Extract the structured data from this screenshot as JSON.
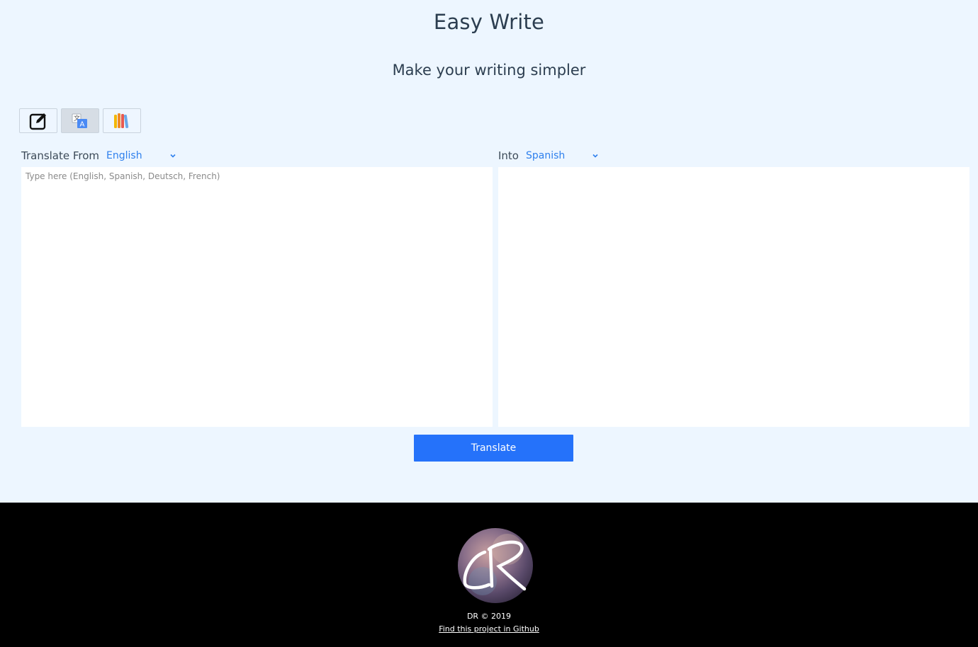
{
  "header": {
    "title": "Easy Write",
    "subtitle": "Make your writing simpler"
  },
  "modes": [
    {
      "name": "edit-mode",
      "icon": "edit-icon",
      "active": false
    },
    {
      "name": "translate-mode",
      "icon": "translate-icon",
      "active": true
    },
    {
      "name": "library-mode",
      "icon": "books-icon",
      "active": false
    }
  ],
  "source": {
    "label": "Translate From",
    "language": "English",
    "placeholder": "Type here (English, Spanish, Deutsch, French)",
    "value": ""
  },
  "target": {
    "label": "Into",
    "language": "Spanish",
    "value": ""
  },
  "actions": {
    "translate_label": "Translate"
  },
  "footer": {
    "logo": "dr-logo",
    "copyright": "DR © 2019",
    "github_link": "Find this project in Github"
  },
  "colors": {
    "background": "#edf6ff",
    "accent": "#2572fa",
    "select_text": "#2f80ed",
    "footer_bg": "#000000"
  }
}
